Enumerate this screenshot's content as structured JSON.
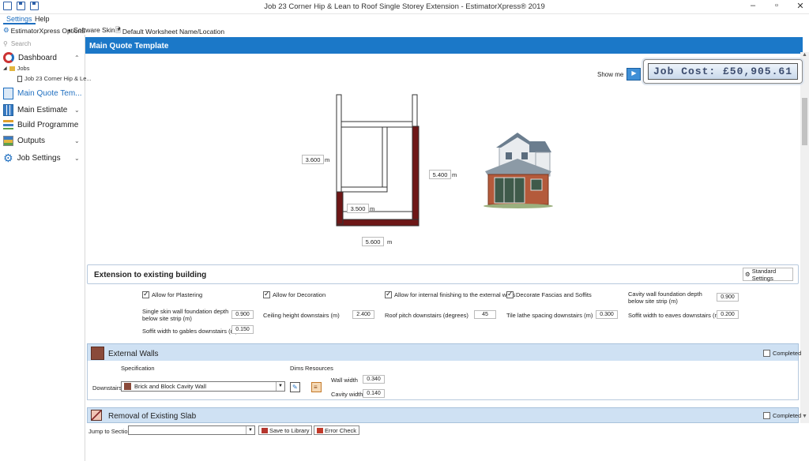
{
  "window": {
    "title": "Job 23 Corner Hip & Lean to Roof Single Storey Extension - EstimatorXpress® 2019",
    "controls": [
      "–",
      "▫",
      "✕"
    ]
  },
  "menu": {
    "items": [
      "Settings",
      "Help"
    ],
    "active": "Settings"
  },
  "toolbar": {
    "options": "EstimatorXpress Options",
    "skin": "Software Skin",
    "worksheet": "Default Worksheet Name/Location"
  },
  "sidebar": {
    "search_placeholder": "Search",
    "dashboard": "Dashboard",
    "jobs": "Jobs",
    "job_item": "Job 23 Corner Hip & Le...",
    "main_quote": "Main Quote Tem...",
    "main_estimate": "Main Estimate",
    "build_programme": "Build Programme",
    "outputs": "Outputs",
    "job_settings": "Job Settings"
  },
  "header": {
    "title": "Main Quote Template"
  },
  "showme": {
    "label": "Show me"
  },
  "job_cost": {
    "label": "Job Cost: £50,905.61"
  },
  "diagram": {
    "dim_left": "3.600",
    "dim_right": "5.400",
    "dim_inner": "3.500",
    "dim_bottom": "5.600",
    "unit": "m"
  },
  "extension": {
    "title": "Extension to existing building",
    "std_settings": "Standard Settings",
    "checks": {
      "plastering": "Allow for Plastering",
      "decoration": "Allow for Decoration",
      "internal": "Allow for internal finishing to the external walls",
      "fascias": "Decorate Fascias and Soffits"
    },
    "fields": {
      "cavity_label": "Cavity wall foundation depth below site strip (m)",
      "cavity_val": "0.900",
      "single_label": "Single skin wall foundation depth below site strip (m)",
      "single_val": "0.900",
      "ceiling_label": "Ceiling height downstairs (m)",
      "ceiling_val": "2.400",
      "pitch_label": "Roof pitch downstairs (degrees)",
      "pitch_val": "45",
      "tile_label": "Tile lathe spacing downstairs (m)",
      "tile_val": "0.300",
      "soffit_eaves_label": "Soffit width to eaves downstairs (m)",
      "soffit_eaves_val": "0.200",
      "soffit_gables_label": "Soffit width to gables downstairs (m)",
      "soffit_gables_val": "0.150"
    }
  },
  "external_walls": {
    "title": "External Walls",
    "completed": "Completed",
    "specification": "Specification",
    "dims": "Dims",
    "resources": "Resources",
    "downstairs": "Downstairs",
    "spec_value": "Brick and Block Cavity Wall",
    "wall_width_label": "Wall width",
    "wall_width_val": "0.340",
    "cavity_width_label": "Cavity width",
    "cavity_width_val": "0.140"
  },
  "removal": {
    "title": "Removal of Existing Slab",
    "completed": "Completed"
  },
  "bottom": {
    "jump_label": "Jump to Section:",
    "save_library": "Save to Library",
    "error_check": "Error Check"
  }
}
